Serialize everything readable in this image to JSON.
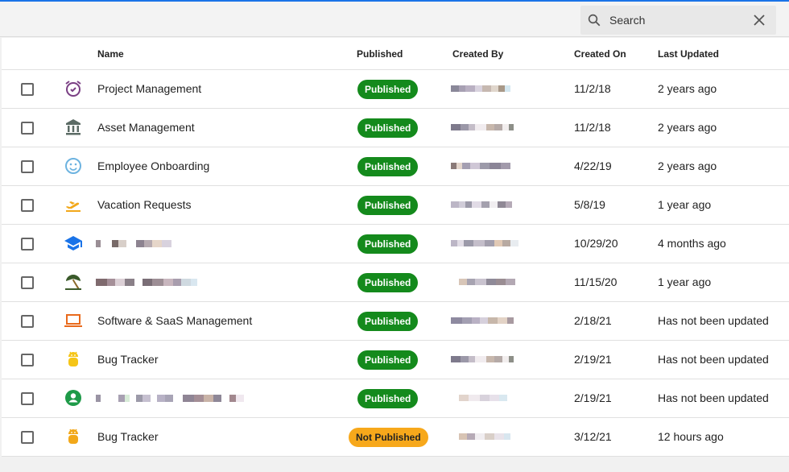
{
  "search": {
    "placeholder": "Search"
  },
  "table": {
    "headers": {
      "name": "Name",
      "published": "Published",
      "created_by": "Created By",
      "created_on": "Created On",
      "last_updated": "Last Updated"
    },
    "rows": [
      {
        "icon": "alarm-clock-icon",
        "icon_color": "#7a3f84",
        "name": "Project Management",
        "status": "Published",
        "created_on": "11/2/18",
        "last_updated": "2 years ago"
      },
      {
        "icon": "bank-icon",
        "icon_color": "#5b6b65",
        "name": "Asset Management",
        "status": "Published",
        "created_on": "11/2/18",
        "last_updated": "2 years ago"
      },
      {
        "icon": "smiley-face-icon",
        "icon_color": "#6db3e0",
        "name": "Employee Onboarding",
        "status": "Published",
        "created_on": "4/22/19",
        "last_updated": "2 years ago"
      },
      {
        "icon": "airplane-takeoff-icon",
        "icon_color": "#f2a81a",
        "name": "Vacation Requests",
        "status": "Published",
        "created_on": "5/8/19",
        "last_updated": "1 year ago"
      },
      {
        "icon": "graduation-cap-icon",
        "icon_color": "#1a73e8",
        "name": "",
        "status": "Published",
        "created_on": "10/29/20",
        "last_updated": "4 months ago"
      },
      {
        "icon": "beach-umbrella-icon",
        "icon_color": "#3a5a2a",
        "name": "",
        "status": "Published",
        "created_on": "11/15/20",
        "last_updated": "1 year ago"
      },
      {
        "icon": "laptop-icon",
        "icon_color": "#e96a1c",
        "name": "Software & SaaS Management",
        "status": "Published",
        "created_on": "2/18/21",
        "last_updated": "Has not been updated"
      },
      {
        "icon": "android-bug-icon",
        "icon_color": "#f5c518",
        "name": "Bug Tracker",
        "status": "Published",
        "created_on": "2/19/21",
        "last_updated": "Has not been updated"
      },
      {
        "icon": "account-circle-icon",
        "icon_color": "#1e9a48",
        "name": "",
        "status": "Published",
        "created_on": "2/19/21",
        "last_updated": "Has not been updated"
      },
      {
        "icon": "android-bug-icon",
        "icon_color": "#f2a81a",
        "name": "Bug Tracker",
        "status": "Not Published",
        "created_on": "3/12/21",
        "last_updated": "12 hours ago"
      }
    ]
  },
  "colors": {
    "accent": "#1a73e8",
    "published": "#148a1c",
    "not_published": "#f7a81b"
  }
}
